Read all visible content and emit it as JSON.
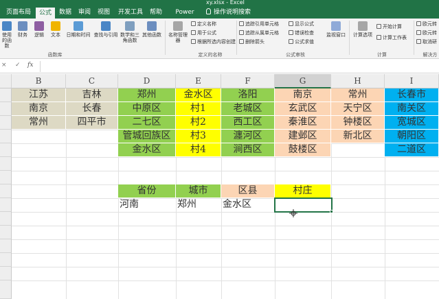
{
  "window": {
    "title": "xy.xlsx - Excel"
  },
  "tabs": [
    {
      "label": "页面布局"
    },
    {
      "label": "公式"
    },
    {
      "label": "数据"
    },
    {
      "label": "审阅"
    },
    {
      "label": "视图"
    },
    {
      "label": "开发工具"
    },
    {
      "label": "帮助"
    },
    {
      "label": "Power Pivot"
    },
    {
      "label": "操作说明搜索"
    }
  ],
  "ribbon": {
    "buttons": [
      {
        "label": "使用的函数",
        "icon": "function-icon"
      },
      {
        "label": "财务",
        "icon": "finance-icon"
      },
      {
        "label": "逻辑",
        "icon": "logic-icon"
      },
      {
        "label": "文本",
        "icon": "text-icon"
      },
      {
        "label": "日期和时间",
        "icon": "calendar-icon"
      },
      {
        "label": "查找与引用",
        "icon": "lookup-icon"
      },
      {
        "label": "数学和三角函数",
        "icon": "math-icon"
      },
      {
        "label": "其他函数",
        "icon": "more-functions-icon"
      },
      {
        "label": "名称管理器",
        "icon": "name-manager-icon"
      },
      {
        "label": "监视窗口",
        "icon": "watch-window-icon"
      },
      {
        "label": "计算选项",
        "icon": "calc-options-icon"
      }
    ],
    "small": [
      {
        "label": "定义名称"
      },
      {
        "label": "用于公式"
      },
      {
        "label": "根据所选内容创建"
      },
      {
        "label": "追踪引用单元格"
      },
      {
        "label": "追踪从属单元格"
      },
      {
        "label": "删除箭头"
      },
      {
        "label": "显示公式"
      },
      {
        "label": "错误检查"
      },
      {
        "label": "公式求值"
      },
      {
        "label": "开始计算"
      },
      {
        "label": "计算工作表"
      },
      {
        "label": "欧元转"
      },
      {
        "label": "欧元转"
      },
      {
        "label": "取消研"
      }
    ],
    "groups": [
      {
        "label": "函数库"
      },
      {
        "label": "定义的名称"
      },
      {
        "label": "公式审核"
      },
      {
        "label": "计算"
      },
      {
        "label": "解决方"
      }
    ]
  },
  "formula_bar": {
    "cancel": "×",
    "enter": "✓",
    "fx": "fx",
    "value": ""
  },
  "columns": [
    "B",
    "C",
    "D",
    "E",
    "F",
    "G",
    "H",
    "I"
  ],
  "selected_column": "G",
  "colors": {
    "accent": "#217346",
    "tan": "#DDD9C4",
    "green": "#92D050",
    "yellow": "#FFFF00",
    "peach": "#FCD5B4",
    "blue": "#00B0F0"
  },
  "sheet": {
    "provinces": [
      "江苏",
      "南京",
      "常州"
    ],
    "cities_c": [
      "吉林",
      "长春",
      "四平市"
    ],
    "zhengzhou": [
      "郑州",
      "中原区",
      "二七区",
      "管城回族区",
      "金水区"
    ],
    "jinshui": [
      "金水区",
      "村1",
      "村2",
      "村3",
      "村4"
    ],
    "luoyang": [
      "洛阳",
      "老城区",
      "西工区",
      "瀍河区",
      "涧西区"
    ],
    "nanjing": [
      "南京",
      "玄武区",
      "秦淮区",
      "建邺区",
      "鼓楼区"
    ],
    "changzhou": [
      "常州",
      "天宁区",
      "钟楼区",
      "新北区"
    ],
    "changchun": [
      "长春市",
      "南关区",
      "宽城区",
      "朝阳区",
      "二道区"
    ],
    "form_headers": [
      "省份",
      "城市",
      "区县",
      "村庄"
    ],
    "form_values": [
      "河南",
      "郑州",
      "金水区",
      ""
    ]
  }
}
